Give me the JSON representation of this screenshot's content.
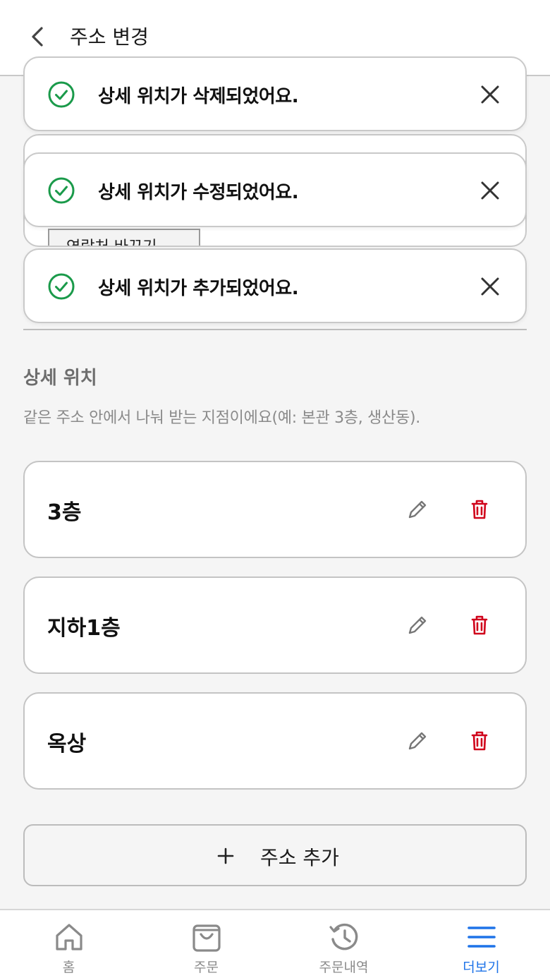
{
  "header": {
    "title": "주소 변경"
  },
  "behind": {
    "contact_button_label": "연락처 바꾸기"
  },
  "toasts": [
    {
      "message": "상세 위치가 삭제되었어요."
    },
    {
      "message": "상세 위치가 수정되었어요."
    },
    {
      "message": "상세 위치가 추가되었어요."
    }
  ],
  "section": {
    "title": "상세 위치",
    "description": "같은 주소 안에서 나눠 받는 지점이에요(예: 본관 3층, 생산동)."
  },
  "locations": [
    {
      "name": "3층"
    },
    {
      "name": "지하1층"
    },
    {
      "name": "옥상"
    }
  ],
  "add_button": {
    "label": "주소 추가"
  },
  "tabbar": {
    "tabs": [
      {
        "label": "홈",
        "icon": "home-icon"
      },
      {
        "label": "주문",
        "icon": "bag-icon"
      },
      {
        "label": "주문내역",
        "icon": "history-icon"
      },
      {
        "label": "더보기",
        "icon": "menu-icon"
      }
    ],
    "active_index": 3
  },
  "colors": {
    "success": "#1a9a4a",
    "danger": "#d0021b",
    "accent": "#1e73e8"
  }
}
